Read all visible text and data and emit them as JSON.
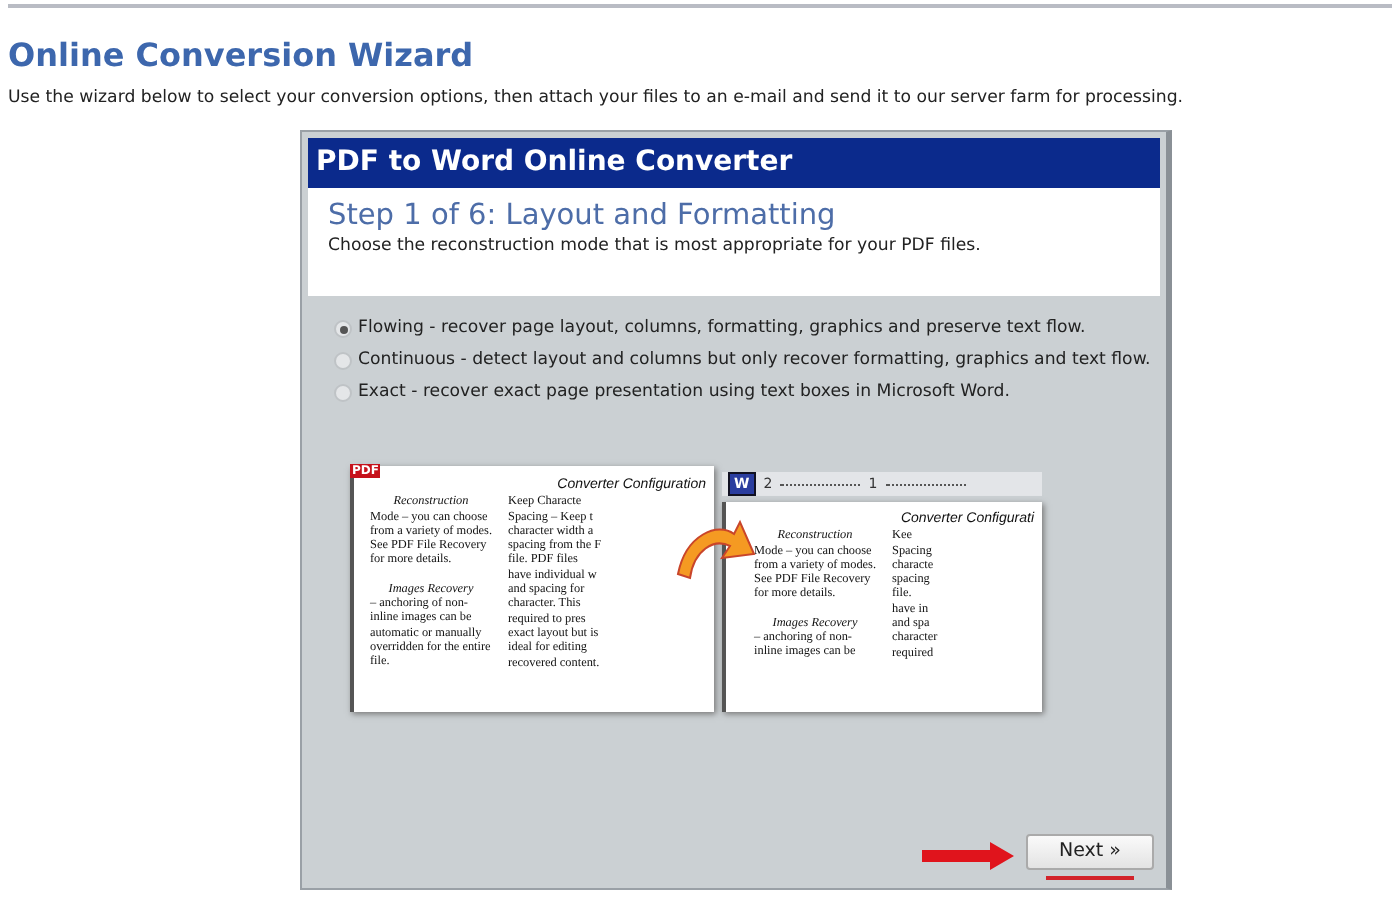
{
  "page": {
    "title": "Online Conversion Wizard",
    "description": "Use the wizard below to select your conversion options, then attach your files to an e-mail and send it to our server farm for processing."
  },
  "wizard": {
    "title": "PDF to Word Online Converter",
    "step_title": "Step 1 of 6: Layout and Formatting",
    "step_description": "Choose the reconstruction mode that is most appropriate for your PDF files.",
    "options": [
      {
        "label": "Flowing - recover page layout, columns, formatting, graphics and preserve text flow.",
        "selected": true
      },
      {
        "label": "Continuous - detect layout and columns but only recover formatting, graphics and text flow.",
        "selected": false
      },
      {
        "label": "Exact - recover exact page presentation using text boxes in Microsoft Word.",
        "selected": false
      }
    ],
    "illustration": {
      "pdf_document": {
        "badge": "PDF",
        "heading": "Converter Configuration",
        "column_1": [
          [
            "Reconstruction",
            "Mode – you can choose",
            "from a variety of modes.",
            "See PDF File Recovery",
            "for more details."
          ],
          [
            "Images Recovery",
            "– anchoring of non-",
            "inline images can be",
            "automatic or manually",
            "overridden for the entire",
            "file."
          ]
        ],
        "column_2": [
          "Keep Characte",
          "Spacing – Keep t",
          "character width a",
          "spacing from the F",
          "file.  PDF files",
          "have individual w",
          "and spacing for",
          "character.  This",
          "required to pres",
          "exact layout but is",
          "ideal for editing",
          "recovered content."
        ]
      },
      "word_document": {
        "badge": "W",
        "ruler": [
          "2",
          "1"
        ],
        "heading": "Converter Configurati",
        "column_1": [
          [
            "Reconstruction",
            "Mode – you can choose",
            "from a variety of modes.",
            "See PDF File Recovery",
            "for more details."
          ],
          [
            "Images Recovery",
            "– anchoring of non-",
            "inline images can be"
          ]
        ],
        "column_2": [
          "Kee",
          "Spacing",
          "characte",
          "spacing",
          "file.",
          "have in",
          "and spa",
          "character",
          "required"
        ]
      }
    },
    "next_button": "Next »"
  }
}
